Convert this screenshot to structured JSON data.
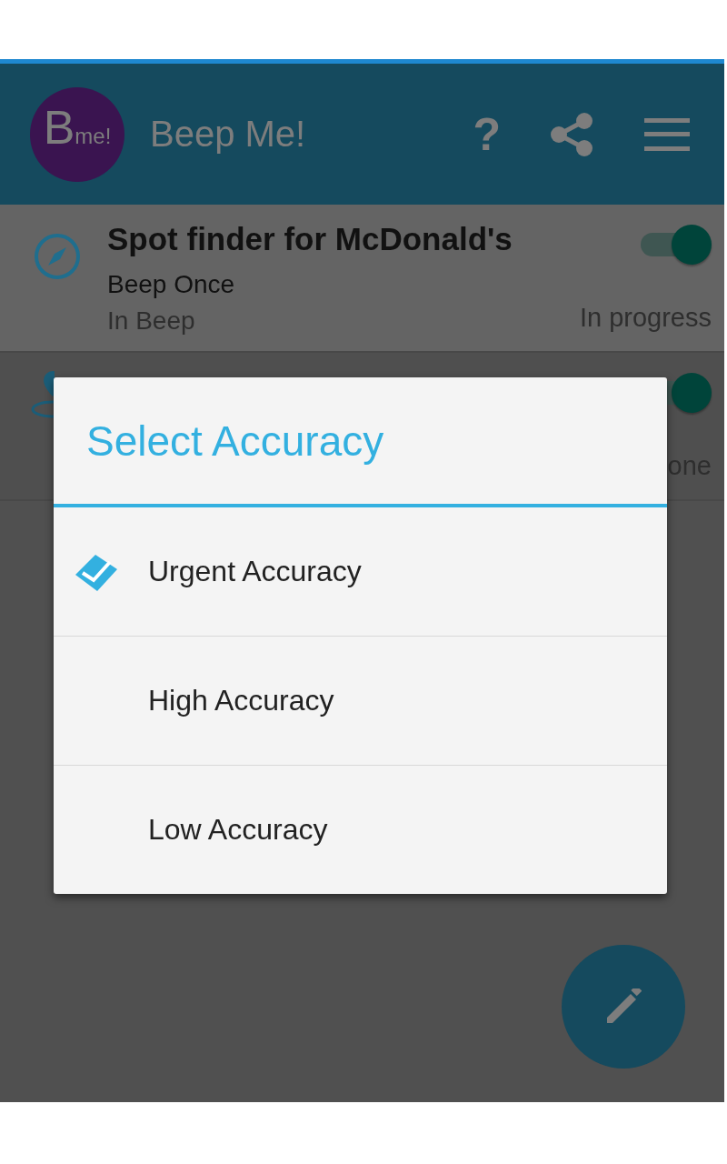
{
  "app_bar": {
    "logo": {
      "letter": "B",
      "suffix": "me!"
    },
    "title": "Beep Me!",
    "actions": [
      "?"
    ]
  },
  "tasks": [
    {
      "title": "Spot finder for McDonald's",
      "mode": "Beep Once",
      "place": "In Beep",
      "status": "In progress",
      "on": true,
      "selected": true,
      "kind": "compass"
    },
    {
      "status": "one",
      "on": true,
      "selected": false,
      "kind": "pin"
    }
  ],
  "dialog": {
    "title": "Select Accuracy",
    "options": [
      {
        "label": "Urgent Accuracy",
        "selected": true
      },
      {
        "label": "High Accuracy",
        "selected": false
      },
      {
        "label": "Low Accuracy",
        "selected": false
      }
    ]
  }
}
